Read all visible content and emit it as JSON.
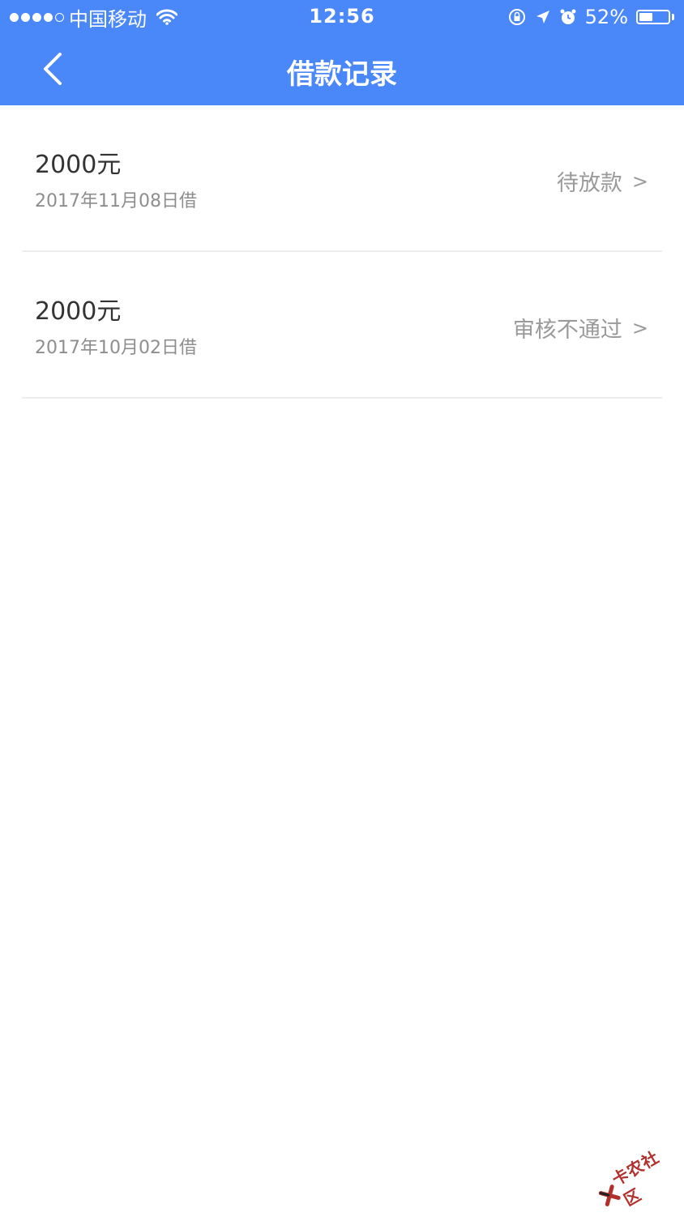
{
  "status_bar": {
    "carrier": "中国移动",
    "time": "12:56",
    "battery": "52%",
    "battery_level": 0.52,
    "icons": [
      "signal-dots-icon",
      "wifi-icon",
      "rotation-lock-icon",
      "location-arrow-icon",
      "alarm-icon",
      "battery-icon"
    ]
  },
  "nav": {
    "title": "借款记录",
    "back_icon": "chevron-left-icon"
  },
  "records": [
    {
      "amount": "2000元",
      "date": "2017年11月08日借",
      "status": "待放款",
      "chevron": ">"
    },
    {
      "amount": "2000元",
      "date": "2017年10月02日借",
      "status": "审核不通过",
      "chevron": ">"
    }
  ],
  "watermark": {
    "text": "卡农社区"
  },
  "colors": {
    "header_bg": "#4a87f9",
    "amount_text": "#333333",
    "secondary_text": "#9a9a9a",
    "divider": "#ededed",
    "watermark": "#b1302c"
  }
}
